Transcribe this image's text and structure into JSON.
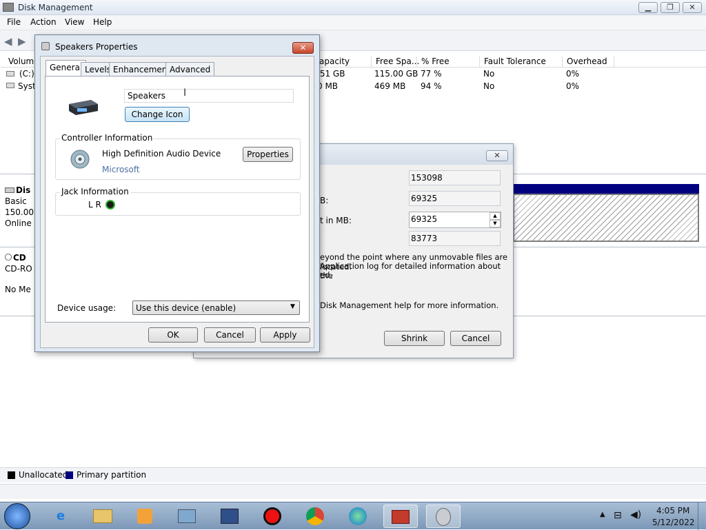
{
  "window": {
    "title": "Disk Management",
    "minimize": "▁",
    "maximize": "❐",
    "close": "✕"
  },
  "menubar": [
    "File",
    "Action",
    "View",
    "Help"
  ],
  "volume_list": {
    "columns": [
      "Volume",
      "apacity",
      "Free Spa...",
      "% Free",
      "Fault Tolerance",
      "Overhead"
    ],
    "rows": [
      {
        "volume": "(C:)",
        "capacity": ".51 GB",
        "free": "115.00 GB",
        "pct": "77 %",
        "fault": "No",
        "overhead": "0%"
      },
      {
        "volume": "Syste",
        "capacity": "0 MB",
        "free": "469 MB",
        "pct": "94 %",
        "fault": "No",
        "overhead": "0%"
      }
    ]
  },
  "disks": [
    {
      "name": "Dis",
      "type": "Basic",
      "size": "150.00",
      "state": "Online"
    },
    {
      "name": "CD",
      "type": "CD-RO",
      "size": "",
      "state": "No Me"
    }
  ],
  "legend": {
    "unallocated": "Unallocated",
    "primary": "Primary partition",
    "unalloc_color": "#000000",
    "primary_color": "#00007f"
  },
  "shrink_dialog": {
    "close": "✕",
    "total_size": "153098",
    "available": "69325",
    "available_suffix": "B:",
    "shrink_amount": "69325",
    "shrink_label": "t in MB:",
    "total_after": "83773",
    "info_line1": "eyond the point where any unmovable files are located.",
    "info_line2": " Application log for detailed information about the",
    "info_line3": "ed.",
    "help_line": " Disk Management help for more information.",
    "shrink_button": "Shrink",
    "cancel_button": "Cancel"
  },
  "speakers_dialog": {
    "title": "Speakers Properties",
    "close": "✕",
    "tabs": [
      "General",
      "Levels",
      "Enhancements",
      "Advanced"
    ],
    "device_name": "Speakers",
    "change_icon": "Change Icon",
    "controller_label": "Controller Information",
    "controller_name": "High Definition Audio Device",
    "controller_vendor": "Microsoft",
    "properties_button": "Properties",
    "jack_label": "Jack Information",
    "jack_lr": "L R",
    "device_usage_label": "Device usage:",
    "device_usage_value": "Use this device (enable)",
    "ok": "OK",
    "cancel": "Cancel",
    "apply": "Apply"
  },
  "taskbar": {
    "time": "4:05 PM",
    "date": "5/12/2022"
  }
}
